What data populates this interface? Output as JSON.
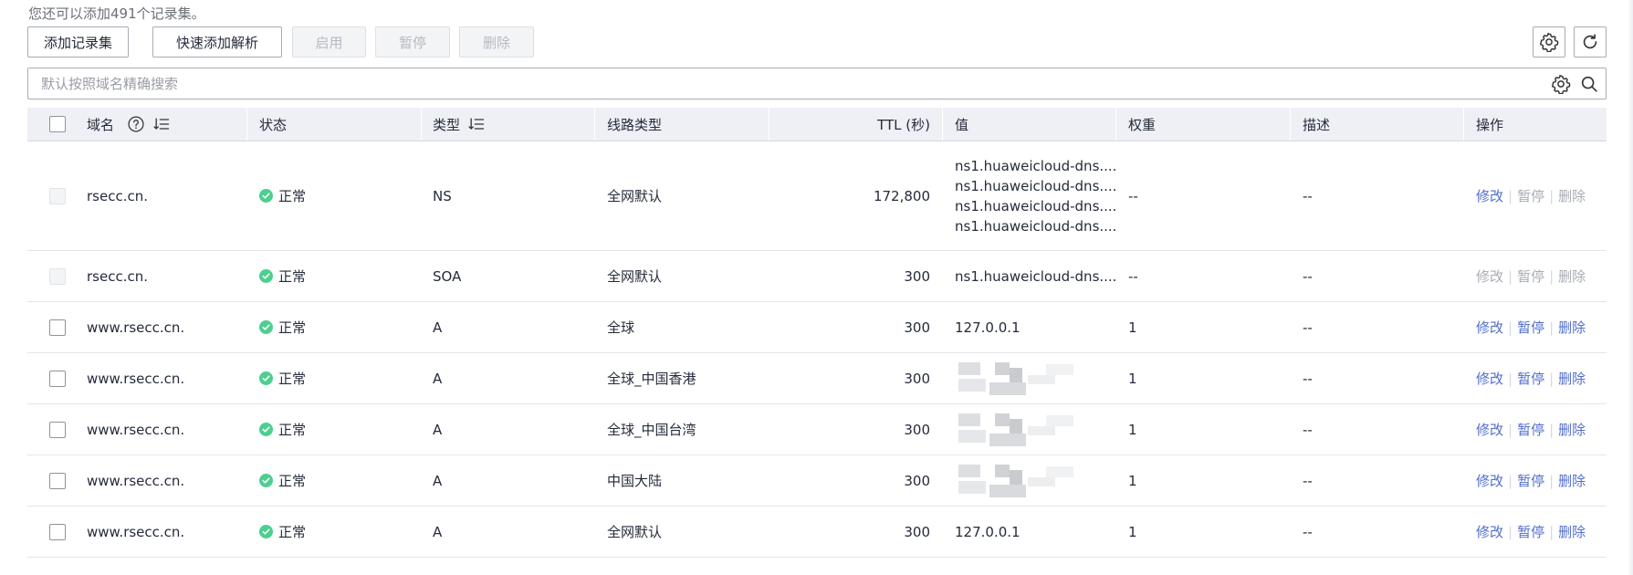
{
  "hint": "您还可以添加491个记录集。",
  "toolbar": {
    "add_record_set": "添加记录集",
    "quick_add": "快速添加解析",
    "enable": "启用",
    "pause": "暂停",
    "delete": "删除"
  },
  "search": {
    "placeholder": "默认按照域名精确搜索"
  },
  "columns": {
    "name": "域名",
    "status": "状态",
    "type": "类型",
    "line": "线路类型",
    "ttl": "TTL (秒)",
    "value": "值",
    "weight": "权重",
    "desc": "描述",
    "ops": "操作"
  },
  "rows": [
    {
      "name": "rsecc.cn.",
      "status": "正常",
      "type": "NS",
      "line": "全网默认",
      "ttl": "172,800",
      "values": [
        "ns1.huaweicloud-dns....",
        "ns1.huaweicloud-dns....",
        "ns1.huaweicloud-dns....",
        "ns1.huaweicloud-dns...."
      ],
      "weight": "--",
      "desc": "--",
      "op_edit": "修改",
      "op_pause": "暂停",
      "op_delete": "删除"
    },
    {
      "name": "rsecc.cn.",
      "status": "正常",
      "type": "SOA",
      "line": "全网默认",
      "ttl": "300",
      "values": [
        "ns1.huaweicloud-dns...."
      ],
      "weight": "--",
      "desc": "--",
      "op_edit": "修改",
      "op_pause": "暂停",
      "op_delete": "删除"
    },
    {
      "name": "www.rsecc.cn.",
      "status": "正常",
      "type": "A",
      "line": "全球",
      "ttl": "300",
      "values": [
        "127.0.0.1"
      ],
      "weight": "1",
      "desc": "--",
      "op_edit": "修改",
      "op_pause": "暂停",
      "op_delete": "删除"
    },
    {
      "name": "www.rsecc.cn.",
      "status": "正常",
      "type": "A",
      "line": "全球_中国香港",
      "ttl": "300",
      "values": [],
      "weight": "1",
      "desc": "--",
      "op_edit": "修改",
      "op_pause": "暂停",
      "op_delete": "删除"
    },
    {
      "name": "www.rsecc.cn.",
      "status": "正常",
      "type": "A",
      "line": "全球_中国台湾",
      "ttl": "300",
      "values": [],
      "weight": "1",
      "desc": "--",
      "op_edit": "修改",
      "op_pause": "暂停",
      "op_delete": "删除"
    },
    {
      "name": "www.rsecc.cn.",
      "status": "正常",
      "type": "A",
      "line": "中国大陆",
      "ttl": "300",
      "values": [],
      "weight": "1",
      "desc": "--",
      "op_edit": "修改",
      "op_pause": "暂停",
      "op_delete": "删除"
    },
    {
      "name": "www.rsecc.cn.",
      "status": "正常",
      "type": "A",
      "line": "全网默认",
      "ttl": "300",
      "values": [
        "127.0.0.1"
      ],
      "weight": "1",
      "desc": "--",
      "op_edit": "修改",
      "op_pause": "暂停",
      "op_delete": "删除"
    }
  ],
  "colors": {
    "accent_link": "#526ecc",
    "status_ok": "#4ccf8f",
    "header_bg": "#eef0f5",
    "disabled_text": "#b6b9c0"
  },
  "icons": {
    "settings": "gear-icon",
    "refresh": "refresh-icon",
    "search": "search-icon",
    "help": "help-circle-icon",
    "sort": "sort-icon",
    "status_ok": "check-circle-icon"
  }
}
